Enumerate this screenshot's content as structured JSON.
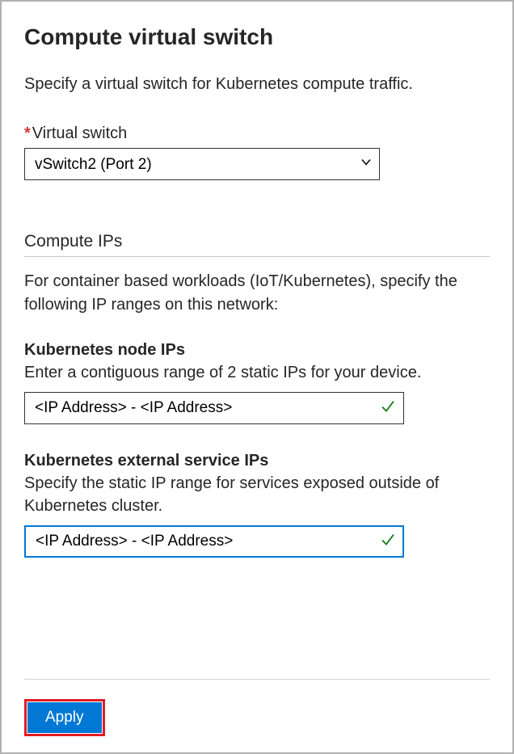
{
  "title": "Compute virtual switch",
  "subtitle": "Specify a virtual switch for Kubernetes compute traffic.",
  "virtual_switch": {
    "required_marker": "*",
    "label": "Virtual switch",
    "selected": "vSwitch2 (Port 2)"
  },
  "compute_ips": {
    "heading": "Compute IPs",
    "description": "For container based workloads (IoT/Kubernetes), specify the following IP ranges on this network:"
  },
  "node_ips": {
    "heading": "Kubernetes node IPs",
    "description": "Enter a contiguous range of 2 static IPs for your device.",
    "value": "<IP Address> - <IP Address>"
  },
  "service_ips": {
    "heading": "Kubernetes external service IPs",
    "description": "Specify the static IP range for services exposed outside of Kubernetes cluster.",
    "value": "<IP Address> - <IP Address>"
  },
  "footer": {
    "apply_label": "Apply"
  }
}
